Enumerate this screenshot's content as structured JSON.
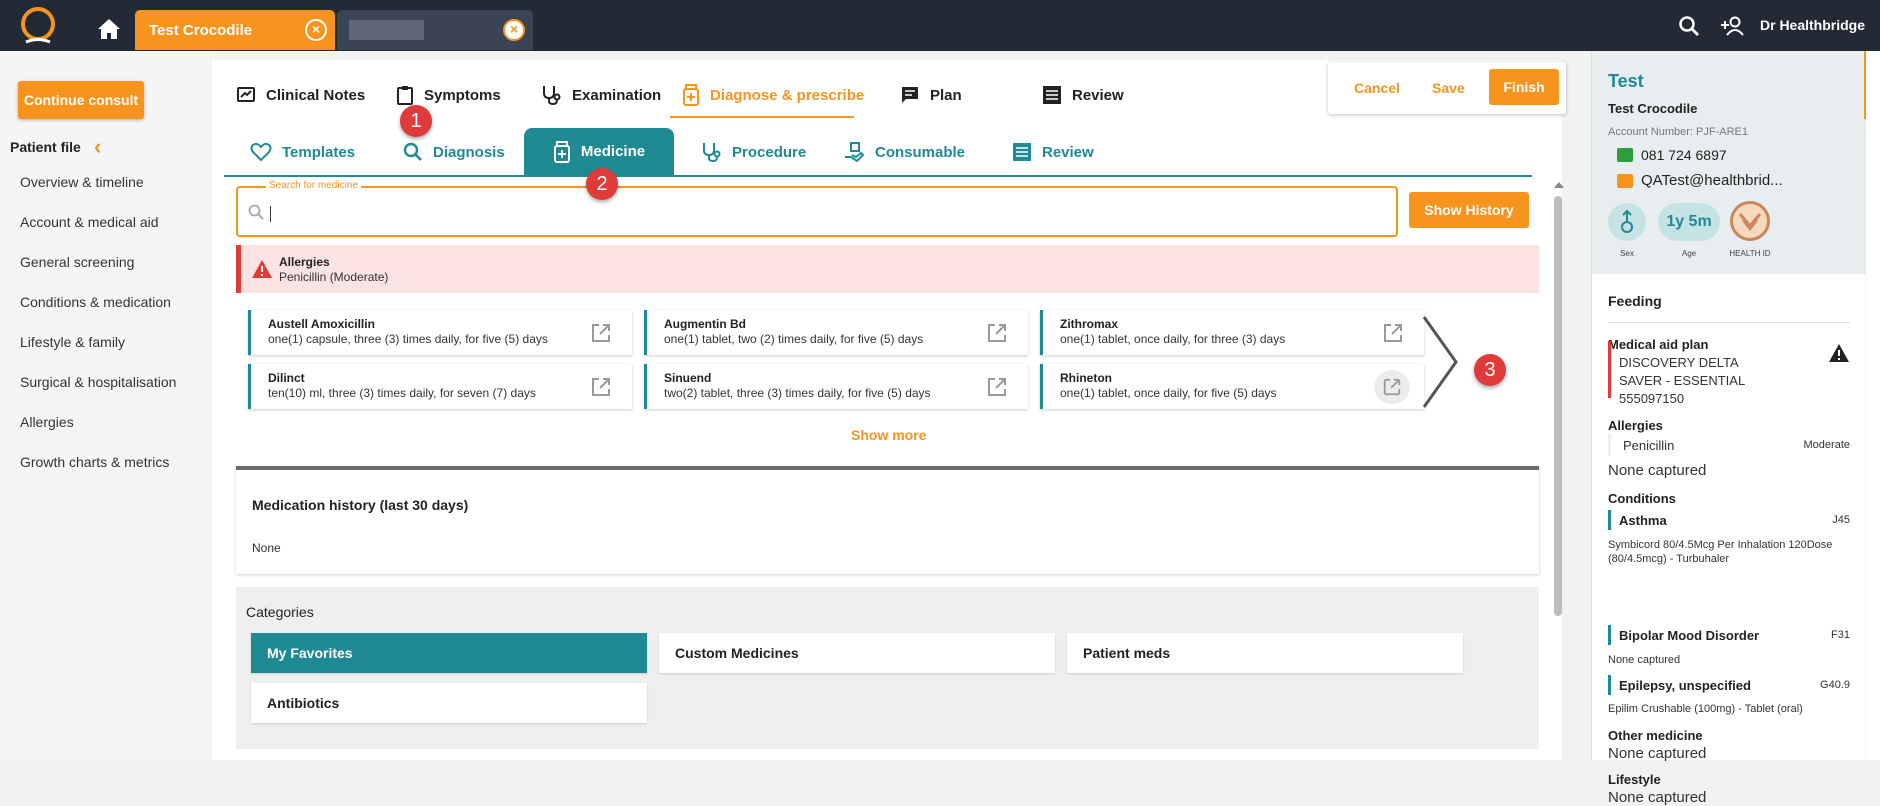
{
  "topbar": {
    "tabs": [
      {
        "label": "Test Crocodile"
      },
      {
        "label": ""
      }
    ],
    "user": "Dr Healthbridge",
    "icons": [
      "logo-icon",
      "home-icon",
      "search-icon",
      "add-user-icon",
      "close-icon"
    ]
  },
  "left": {
    "continue_label": "Continue consult",
    "patient_file": "Patient file",
    "nav": [
      "Overview & timeline",
      "Account & medical aid",
      "General screening",
      "Conditions & medication",
      "Lifestyle & family",
      "Surgical & hospitalisation",
      "Allergies",
      "Growth charts & metrics"
    ]
  },
  "actions": {
    "cancel": "Cancel",
    "save": "Save",
    "finish": "Finish"
  },
  "main_tabs": [
    "Clinical Notes",
    "Symptoms",
    "Examination",
    "Diagnose & prescribe",
    "Plan",
    "Review"
  ],
  "sub_tabs": [
    "Templates",
    "Diagnosis",
    "Medicine",
    "Procedure",
    "Consumable",
    "Review"
  ],
  "search": {
    "label": "Search for medicine",
    "value": "",
    "show_history": "Show History"
  },
  "allergy": {
    "title": "Allergies",
    "text": "Penicillin (Moderate)"
  },
  "cards": [
    {
      "name": "Austell Amoxicillin",
      "desc": "one(1) capsule, three (3) times daily, for five (5) days"
    },
    {
      "name": "Augmentin Bd",
      "desc": "one(1) tablet, two (2) times daily, for five (5) days"
    },
    {
      "name": "Zithromax",
      "desc": "one(1) tablet, once daily, for three (3) days"
    },
    {
      "name": "Dilinct",
      "desc": "ten(10) ml, three (3) times daily, for seven (7) days"
    },
    {
      "name": "Sinuend",
      "desc": "two(2) tablet, three (3) times daily, for five (5) days"
    },
    {
      "name": "Rhineton",
      "desc": "one(1) tablet, once daily, for five (5) days"
    }
  ],
  "show_more": "Show more",
  "med_history": {
    "title": "Medication history (last 30 days)",
    "value": "None"
  },
  "categories": {
    "title": "Categories",
    "items": [
      "My Favorites",
      "Custom Medicines",
      "Patient meds",
      "Antibiotics"
    ]
  },
  "badges": [
    "1",
    "2",
    "3"
  ],
  "right": {
    "name": "Test",
    "full_name": "Test Crocodile",
    "account": "Account Number: PJF-ARE1",
    "phone": "081 724 6897",
    "email": "QATest@healthbrid...",
    "age": "1y 5m",
    "labels": {
      "sex": "Sex",
      "age": "Age",
      "health_id": "HEALTH ID"
    },
    "feeding": "Feeding",
    "medical_aid": {
      "title": "Medical aid plan",
      "lines": [
        "DISCOVERY DELTA",
        "SAVER - ESSENTIAL",
        "555097150"
      ]
    },
    "allergies": {
      "title": "Allergies",
      "name": "Penicillin",
      "severity": "Moderate",
      "none": "None captured"
    },
    "conditions": {
      "title": "Conditions",
      "items": [
        {
          "name": "Asthma",
          "code": "J45",
          "detail": "Symbicord 80/4.5Mcg Per Inhalation 120Dose (80/4.5mcg) - Turbuhaler"
        },
        {
          "name": "Bipolar Mood Disorder",
          "code": "F31",
          "detail": "None captured"
        },
        {
          "name": "Epilepsy, unspecified",
          "code": "G40.9",
          "detail": "Epilim Crushable (100mg) - Tablet (oral)"
        }
      ]
    },
    "other_medicine": {
      "title": "Other medicine",
      "value": "None captured"
    },
    "lifestyle": {
      "title": "Lifestyle",
      "value": "None captured"
    }
  },
  "colors": {
    "orange": "#f7941d",
    "teal": "#1f8a93",
    "dark": "#242a35",
    "red": "#e03b3b"
  }
}
